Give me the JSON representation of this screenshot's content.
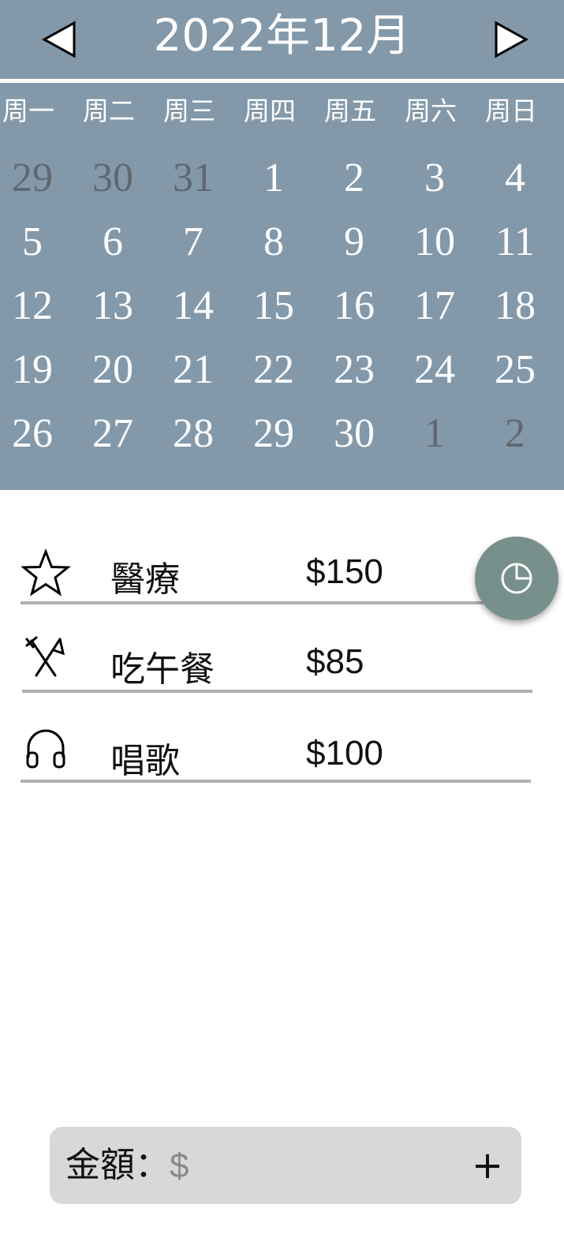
{
  "calendar": {
    "title": "2022年12月",
    "weekdays": [
      "周一",
      "周二",
      "周三",
      "周四",
      "周五",
      "周六",
      "周日"
    ],
    "weeks": [
      [
        {
          "d": "29",
          "other": true
        },
        {
          "d": "30",
          "other": true
        },
        {
          "d": "31",
          "other": true
        },
        {
          "d": "1"
        },
        {
          "d": "2"
        },
        {
          "d": "3"
        },
        {
          "d": "4"
        }
      ],
      [
        {
          "d": "5"
        },
        {
          "d": "6"
        },
        {
          "d": "7"
        },
        {
          "d": "8"
        },
        {
          "d": "9"
        },
        {
          "d": "10"
        },
        {
          "d": "11"
        }
      ],
      [
        {
          "d": "12"
        },
        {
          "d": "13"
        },
        {
          "d": "14"
        },
        {
          "d": "15"
        },
        {
          "d": "16"
        },
        {
          "d": "17"
        },
        {
          "d": "18"
        }
      ],
      [
        {
          "d": "19"
        },
        {
          "d": "20"
        },
        {
          "d": "21"
        },
        {
          "d": "22"
        },
        {
          "d": "23"
        },
        {
          "d": "24"
        },
        {
          "d": "25"
        }
      ],
      [
        {
          "d": "26"
        },
        {
          "d": "27"
        },
        {
          "d": "28"
        },
        {
          "d": "29"
        },
        {
          "d": "30"
        },
        {
          "d": "1",
          "other": true
        },
        {
          "d": "2",
          "other": true
        }
      ]
    ],
    "prev_icon": "triangle-left-icon",
    "next_icon": "triangle-right-icon"
  },
  "expenses": [
    {
      "icon": "star-icon",
      "label": "醫療",
      "amount": "$150"
    },
    {
      "icon": "utensils-icon",
      "label": "吃午餐",
      "amount": "$85"
    },
    {
      "icon": "headphones-icon",
      "label": "唱歌",
      "amount": "$100"
    }
  ],
  "fab": {
    "icon": "pie-chart-icon"
  },
  "input": {
    "label": "金額：",
    "placeholder": "$",
    "add_label": "+"
  },
  "colors": {
    "calendar_bg": "#8399aa",
    "other_month_day": "#5f6870",
    "fab_bg": "#78908b",
    "input_bar_bg": "#d8d8d8",
    "divider": "#b0b0b0"
  }
}
